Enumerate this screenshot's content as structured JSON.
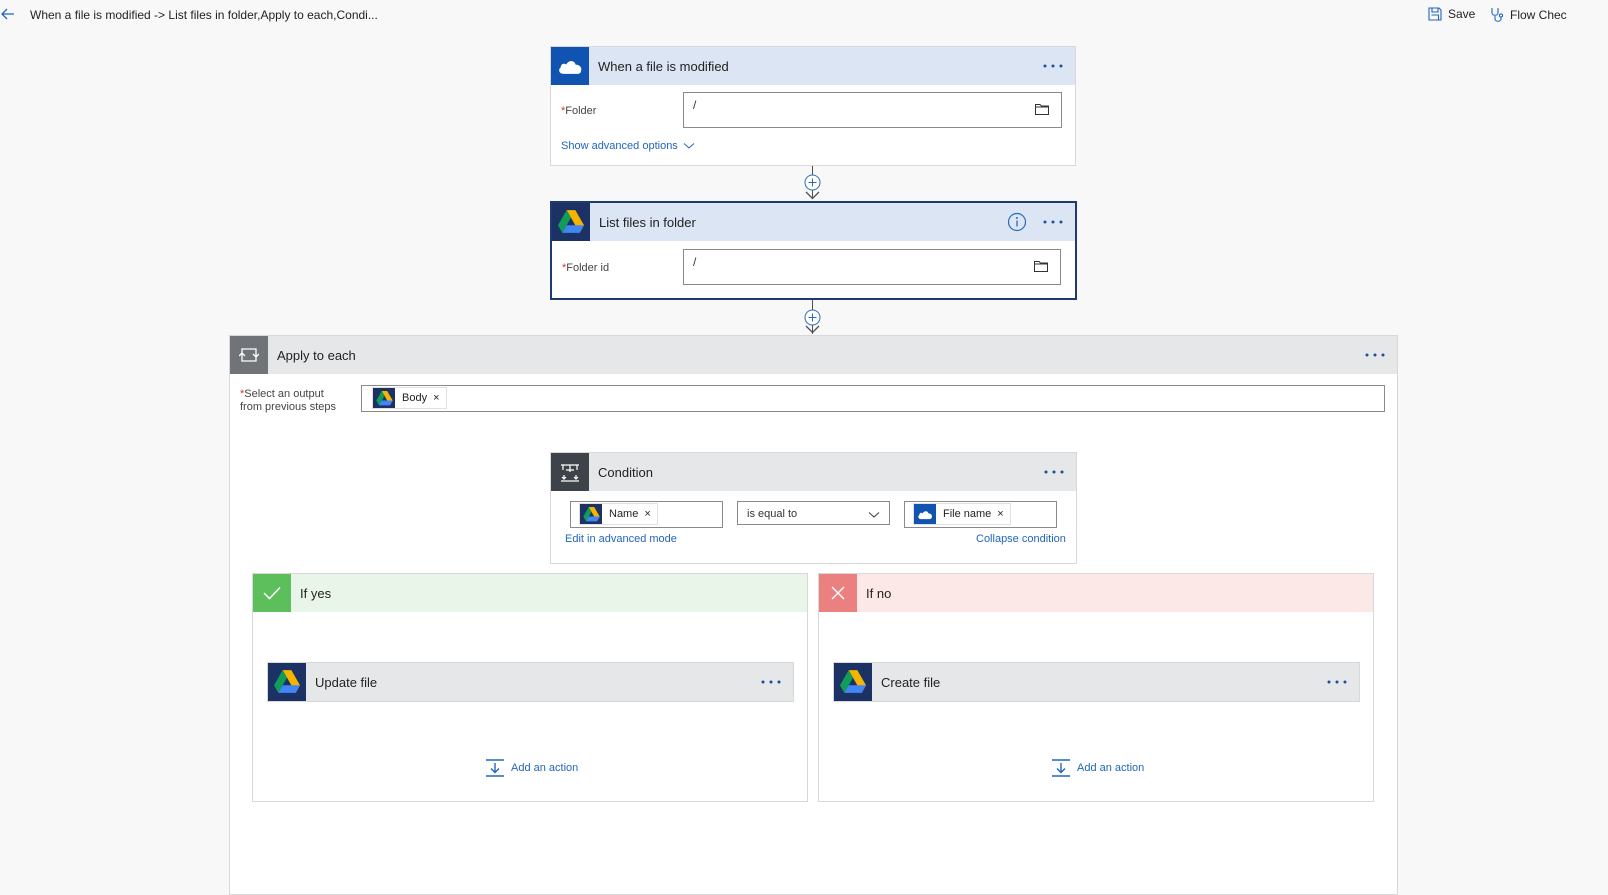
{
  "header": {
    "title": "When a file is modified -> List files in folder,Apply to each,Condi...",
    "save_label": "Save",
    "flow_checker_label": "Flow Chec"
  },
  "trigger": {
    "title": "When a file is modified",
    "folder_label": "Folder",
    "folder_value": "/",
    "advanced_link": "Show advanced options"
  },
  "list_files": {
    "title": "List files in folder",
    "folder_id_label": "Folder id",
    "folder_id_value": "/"
  },
  "apply_each": {
    "title": "Apply to each",
    "select_label_line1": "Select an output",
    "select_label_line2": "from previous steps",
    "token": "Body"
  },
  "condition": {
    "title": "Condition",
    "left_token": "Name",
    "operator": "is equal to",
    "right_token": "File name",
    "edit_link": "Edit in advanced mode",
    "collapse_link": "Collapse condition"
  },
  "if_yes": {
    "title": "If yes",
    "action_title": "Update file",
    "add_action": "Add an action"
  },
  "if_no": {
    "title": "If no",
    "action_title": "Create file",
    "add_action": "Add an action"
  },
  "colors": {
    "accent_blue": "#2266bb",
    "header_blue": "#dbe5f3",
    "header_gray": "#e6e7e8",
    "yes_green": "#5cbf5c",
    "no_red": "#ea8080"
  },
  "icons": {
    "trigger": "onedrive-icon",
    "list_files": "google-drive-icon",
    "apply_each": "loop-icon",
    "condition": "condition-icon"
  }
}
